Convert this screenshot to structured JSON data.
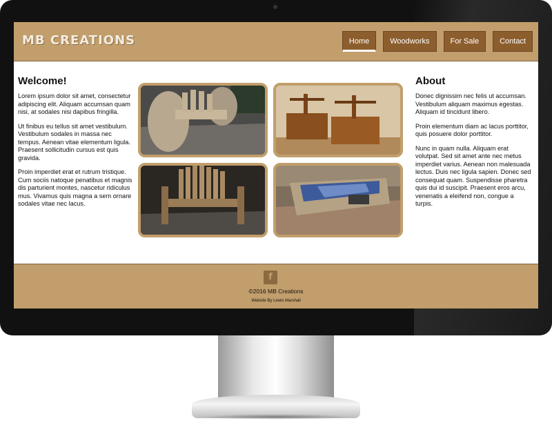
{
  "site": {
    "logo": "MB CREATIONS",
    "nav": [
      {
        "label": "Home",
        "active": true
      },
      {
        "label": "Woodworks",
        "active": false
      },
      {
        "label": "For Sale",
        "active": false
      },
      {
        "label": "Contact",
        "active": false
      }
    ]
  },
  "left": {
    "heading": "Welcome!",
    "paragraphs": [
      "Lorem ipsum dolor sit amet, consectetur adipiscing elit. Aliquam accumsan quam nisi, at sodales nisi dapibus fringilla.",
      "Ut finibus eu tellus sit amet vestibulum. Vestibulum sodales in massa nec tempus. Aenean vitae elementum ligula. Praesent sollicitudin cursus est quis gravida.",
      "Proin imperdiet erat et rutrum tristique. Cum sociis natoque penatibus et magnis dis parturient montes, nascetur ridiculus mus. Vivamus quis magna a sem ornare sodales vitae nec lacus."
    ]
  },
  "right": {
    "heading": "About",
    "paragraphs": [
      "Donec dignissim nec felis ut accumsan. Vestibulum aliquam maximus egestas. Aliquam id tincidunt libero.",
      "Proin elementum diam ac lacus porttitor, quis posuere dolor porttitor.",
      "Nunc in quam nulla. Aliquam erat volutpat. Sed sit amet ante nec metus imperdiet varius. Aenean non malesuada lectus. Duis nec ligula sapien. Donec sed consequat quam. Suspendisse pharetra quis dui id suscipit. Praesent eros arcu, venenatis a eleifend non, congue a turpis."
    ]
  },
  "gallery": [
    {
      "subject": "cable-reel-bench-photo"
    },
    {
      "subject": "wooden-carriers-photo"
    },
    {
      "subject": "pallet-bench-photo"
    },
    {
      "subject": "pallet-pet-bed-photo"
    }
  ],
  "footer": {
    "social_icon": "facebook-icon",
    "social_glyph": "f",
    "copyright": "©2016 MB Creations",
    "credit": "Website By Lewis Marshall"
  },
  "colors": {
    "brand_tan": "#c29e6c",
    "button_brown": "#8c5e2e",
    "monitor_bezel": "#111111"
  }
}
